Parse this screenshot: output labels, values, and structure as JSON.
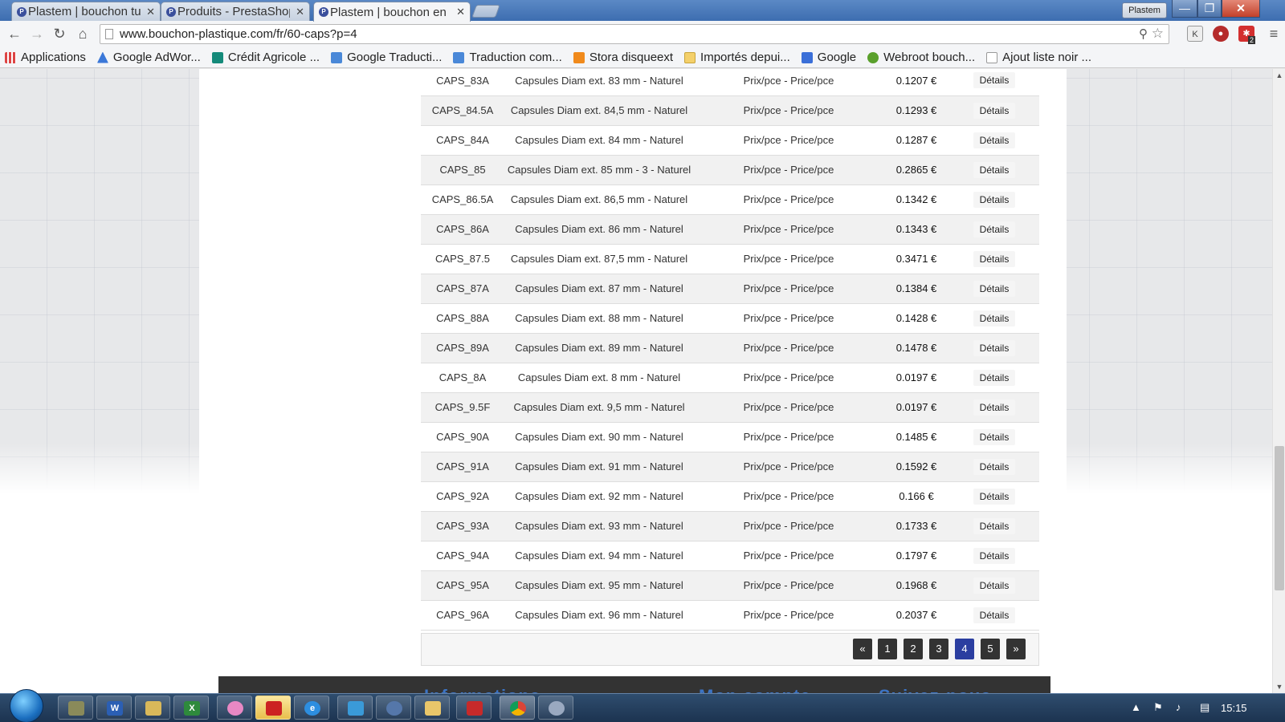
{
  "browser": {
    "tabs": [
      {
        "title": "Plastem | bouchon tu",
        "active": false
      },
      {
        "title": "Produits - PrestaShop",
        "active": false
      },
      {
        "title": "Plastem | bouchon en",
        "active": true
      }
    ],
    "profile_label": "Plastem",
    "window_controls": {
      "minimize": "—",
      "maximize": "❐",
      "close": "✕"
    },
    "url": "www.bouchon-plastique.com/fr/60-caps?p=4",
    "ext_k_label": "K",
    "ext_badge": "2",
    "bookmarks": [
      {
        "label": "Applications",
        "icon": "apps-grid-icon"
      },
      {
        "label": "Google AdWor...",
        "icon": "adwords-icon"
      },
      {
        "label": "Crédit Agricole ...",
        "icon": "bank-icon"
      },
      {
        "label": "Google Traducti...",
        "icon": "translate-icon"
      },
      {
        "label": "Traduction com...",
        "icon": "translate-icon"
      },
      {
        "label": "Stora disqueext",
        "icon": "orange-square-icon"
      },
      {
        "label": "Importés depui...",
        "icon": "folder-icon"
      },
      {
        "label": "Google",
        "icon": "google-icon"
      },
      {
        "label": "Webroot bouch...",
        "icon": "webroot-icon"
      },
      {
        "label": "Ajout liste noir ...",
        "icon": "page-icon"
      }
    ]
  },
  "products": {
    "details_label": "Détails",
    "rows": [
      {
        "ref": "CAPS_83A",
        "name": "Capsules Diam ext. 83 mm - Naturel",
        "unit": "Prix/pce - Price/pce",
        "price": "0.1207 €"
      },
      {
        "ref": "CAPS_84.5A",
        "name": "Capsules Diam ext. 84,5 mm - Naturel",
        "unit": "Prix/pce - Price/pce",
        "price": "0.1293 €"
      },
      {
        "ref": "CAPS_84A",
        "name": "Capsules Diam ext. 84 mm - Naturel",
        "unit": "Prix/pce - Price/pce",
        "price": "0.1287 €"
      },
      {
        "ref": "CAPS_85",
        "name": "Capsules Diam ext. 85 mm - 3 - Naturel",
        "unit": "Prix/pce - Price/pce",
        "price": "0.2865 €"
      },
      {
        "ref": "CAPS_86.5A",
        "name": "Capsules Diam ext. 86,5 mm - Naturel",
        "unit": "Prix/pce - Price/pce",
        "price": "0.1342 €"
      },
      {
        "ref": "CAPS_86A",
        "name": "Capsules Diam ext. 86 mm - Naturel",
        "unit": "Prix/pce - Price/pce",
        "price": "0.1343 €"
      },
      {
        "ref": "CAPS_87.5",
        "name": "Capsules Diam ext. 87,5 mm - Naturel",
        "unit": "Prix/pce - Price/pce",
        "price": "0.3471 €"
      },
      {
        "ref": "CAPS_87A",
        "name": "Capsules Diam ext. 87 mm - Naturel",
        "unit": "Prix/pce - Price/pce",
        "price": "0.1384 €"
      },
      {
        "ref": "CAPS_88A",
        "name": "Capsules Diam ext. 88 mm - Naturel",
        "unit": "Prix/pce - Price/pce",
        "price": "0.1428 €"
      },
      {
        "ref": "CAPS_89A",
        "name": "Capsules Diam ext. 89 mm - Naturel",
        "unit": "Prix/pce - Price/pce",
        "price": "0.1478 €"
      },
      {
        "ref": "CAPS_8A",
        "name": "Capsules Diam ext. 8 mm - Naturel",
        "unit": "Prix/pce - Price/pce",
        "price": "0.0197 €"
      },
      {
        "ref": "CAPS_9.5F",
        "name": "Capsules Diam ext. 9,5 mm - Naturel",
        "unit": "Prix/pce - Price/pce",
        "price": "0.0197 €"
      },
      {
        "ref": "CAPS_90A",
        "name": "Capsules Diam ext. 90 mm - Naturel",
        "unit": "Prix/pce - Price/pce",
        "price": "0.1485 €"
      },
      {
        "ref": "CAPS_91A",
        "name": "Capsules Diam ext. 91 mm - Naturel",
        "unit": "Prix/pce - Price/pce",
        "price": "0.1592 €"
      },
      {
        "ref": "CAPS_92A",
        "name": "Capsules Diam ext. 92 mm - Naturel",
        "unit": "Prix/pce - Price/pce",
        "price": "0.166 €"
      },
      {
        "ref": "CAPS_93A",
        "name": "Capsules Diam ext. 93 mm - Naturel",
        "unit": "Prix/pce - Price/pce",
        "price": "0.1733 €"
      },
      {
        "ref": "CAPS_94A",
        "name": "Capsules Diam ext. 94 mm - Naturel",
        "unit": "Prix/pce - Price/pce",
        "price": "0.1797 €"
      },
      {
        "ref": "CAPS_95A",
        "name": "Capsules Diam ext. 95 mm - Naturel",
        "unit": "Prix/pce - Price/pce",
        "price": "0.1968 €"
      },
      {
        "ref": "CAPS_96A",
        "name": "Capsules Diam ext. 96 mm - Naturel",
        "unit": "Prix/pce - Price/pce",
        "price": "0.2037 €"
      }
    ]
  },
  "pagination": {
    "prev": "«",
    "pages": [
      "1",
      "2",
      "3",
      "4",
      "5"
    ],
    "current": "4",
    "next": "»"
  },
  "footer": {
    "partial_text": [
      "Informations",
      "Mon compte",
      "Suivez-nous"
    ]
  },
  "taskbar": {
    "clock": "15:15",
    "apps": [
      "file-manager-icon",
      "word-icon",
      "explorer-icon",
      "excel-icon",
      "paint-icon",
      "puzzle-app-icon",
      "ie-icon",
      "app-icon",
      "camera-icon",
      "folder-icon",
      "acrobat-icon",
      "chrome-icon",
      "paint-brush-icon"
    ]
  },
  "colors": {
    "accent_blue": "#2b3ea0",
    "footer_dark": "#333333",
    "row_alt": "#f1f1f1"
  }
}
